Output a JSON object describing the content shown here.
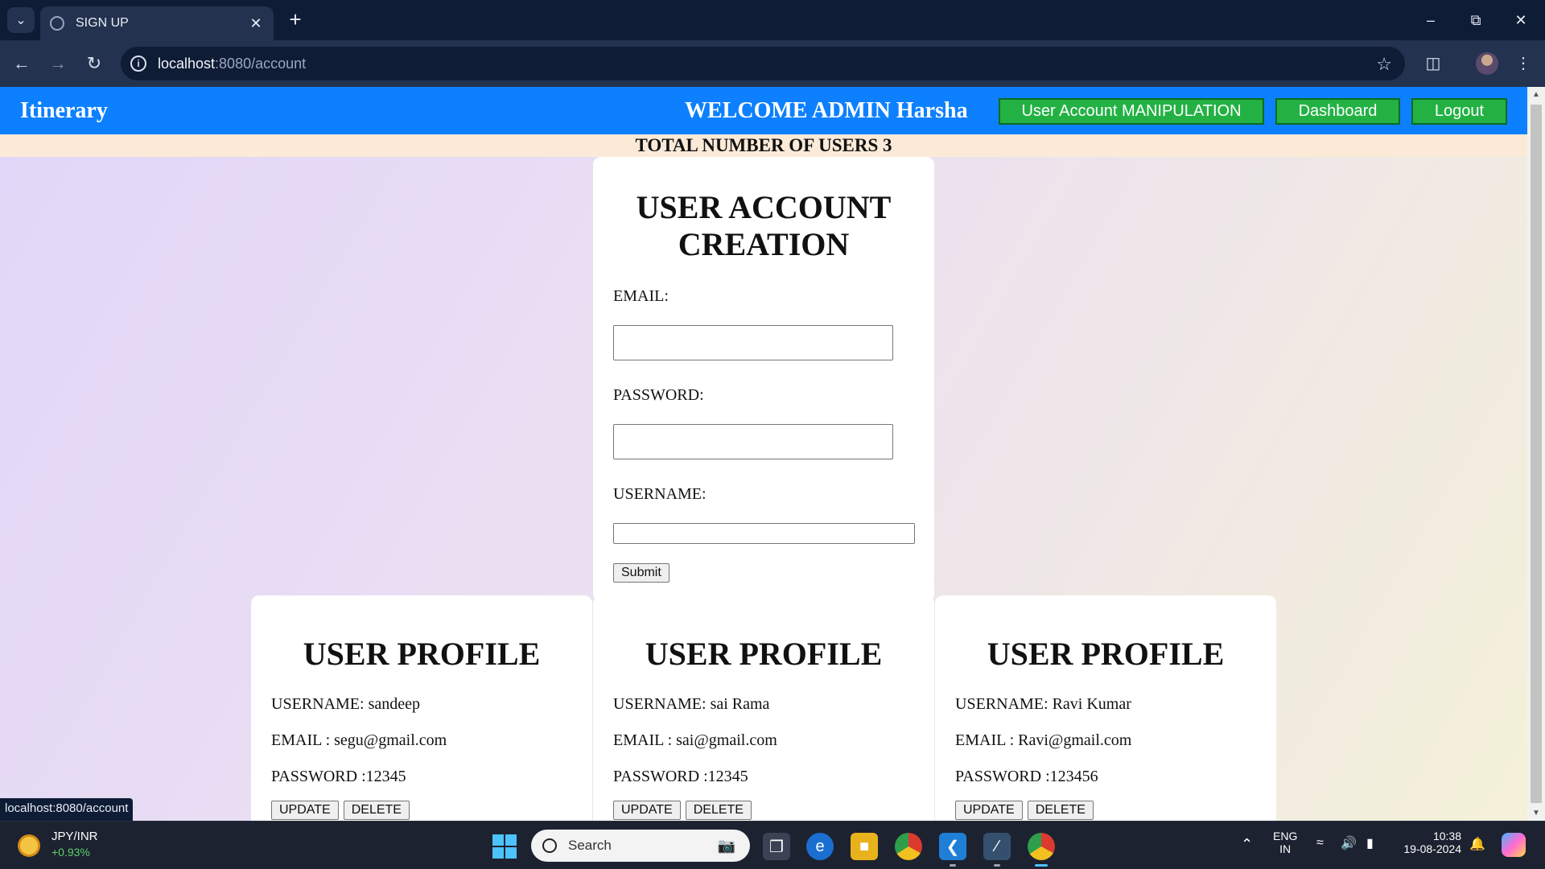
{
  "browser": {
    "tab_title": "SIGN UP",
    "url_host": "localhost",
    "url_path": ":8080/account",
    "status_url": "localhost:8080/account"
  },
  "site": {
    "brand": "Itinerary",
    "welcome": "WELCOME ADMIN Harsha",
    "nav": {
      "manipulation": "User Account MANIPULATION",
      "dashboard": "Dashboard",
      "logout": "Logout"
    },
    "total_users_label": "TOTAL NUMBER OF USERS 3"
  },
  "create_form": {
    "title": "USER ACCOUNT CREATION",
    "email_label": "EMAIL:",
    "email_value": "",
    "password_label": "PASSWORD:",
    "password_value": "",
    "username_label": "USERNAME:",
    "username_value": "",
    "submit_label": "Submit"
  },
  "profiles": [
    {
      "title": "USER PROFILE",
      "username": "USERNAME: sandeep",
      "email": "EMAIL : segu@gmail.com",
      "password": "PASSWORD :12345",
      "update": "UPDATE",
      "delete": "DELETE"
    },
    {
      "title": "USER PROFILE",
      "username": "USERNAME: sai Rama",
      "email": "EMAIL : sai@gmail.com",
      "password": "PASSWORD :12345",
      "update": "UPDATE",
      "delete": "DELETE"
    },
    {
      "title": "USER PROFILE",
      "username": "USERNAME: Ravi Kumar",
      "email": "EMAIL : Ravi@gmail.com",
      "password": "PASSWORD :123456",
      "update": "UPDATE",
      "delete": "DELETE"
    }
  ],
  "taskbar": {
    "ticker_name": "JPY/INR",
    "ticker_change": "+0.93%",
    "search_placeholder": "Search",
    "lang_top": "ENG",
    "lang_bottom": "IN",
    "time": "10:38",
    "date": "19-08-2024"
  },
  "colors": {
    "site_nav": "#0d80ff",
    "nav_button": "#23b144",
    "user_bar": "#fbead7"
  }
}
